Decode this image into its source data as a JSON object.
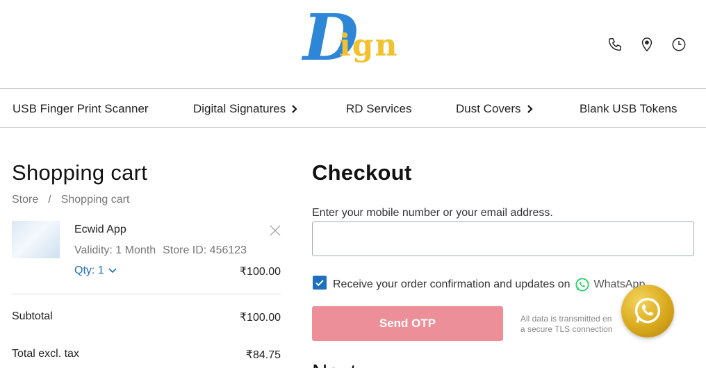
{
  "header": {
    "logo_initial": "D",
    "logo_rest": "ign",
    "icons": [
      "phone-icon",
      "location-pin-icon",
      "clock-icon"
    ]
  },
  "nav": {
    "items": [
      {
        "label": "USB Finger Print Scanner",
        "has_submenu": false
      },
      {
        "label": "Digital Signatures",
        "has_submenu": true
      },
      {
        "label": "RD Services",
        "has_submenu": false
      },
      {
        "label": "Dust Covers",
        "has_submenu": true
      },
      {
        "label": "Blank USB Tokens",
        "has_submenu": false
      }
    ]
  },
  "cart": {
    "title": "Shopping cart",
    "breadcrumb": {
      "store": "Store",
      "separator": "/",
      "current": "Shopping cart"
    },
    "item": {
      "name": "Ecwid App",
      "validity": "Validity: 1 Month",
      "store_id": "Store ID: 456123",
      "qty": "Qty: 1",
      "price": "₹100.00"
    },
    "subtotal_label": "Subtotal",
    "subtotal_value": "₹100.00",
    "total_excl_label": "Total excl. tax",
    "total_excl_value": "₹84.75"
  },
  "checkout": {
    "title": "Checkout",
    "contact_label": "Enter your mobile number or your email address.",
    "contact_value": "",
    "whatsapp_optin_label": "Receive your order confirmation and updates on",
    "whatsapp_brand": "WhatsApp",
    "whatsapp_checked": true,
    "otp_button": "Send OTP",
    "secure_note_line1": "All data is transmitted en",
    "secure_note_line2": "a secure TLS connection",
    "next_section_peek": "Next"
  },
  "colors": {
    "accent": "#1f6fbf",
    "otp_button": "#ec8f99",
    "whatsapp_green": "#25d366",
    "fab_gold": "#d9a91c"
  }
}
